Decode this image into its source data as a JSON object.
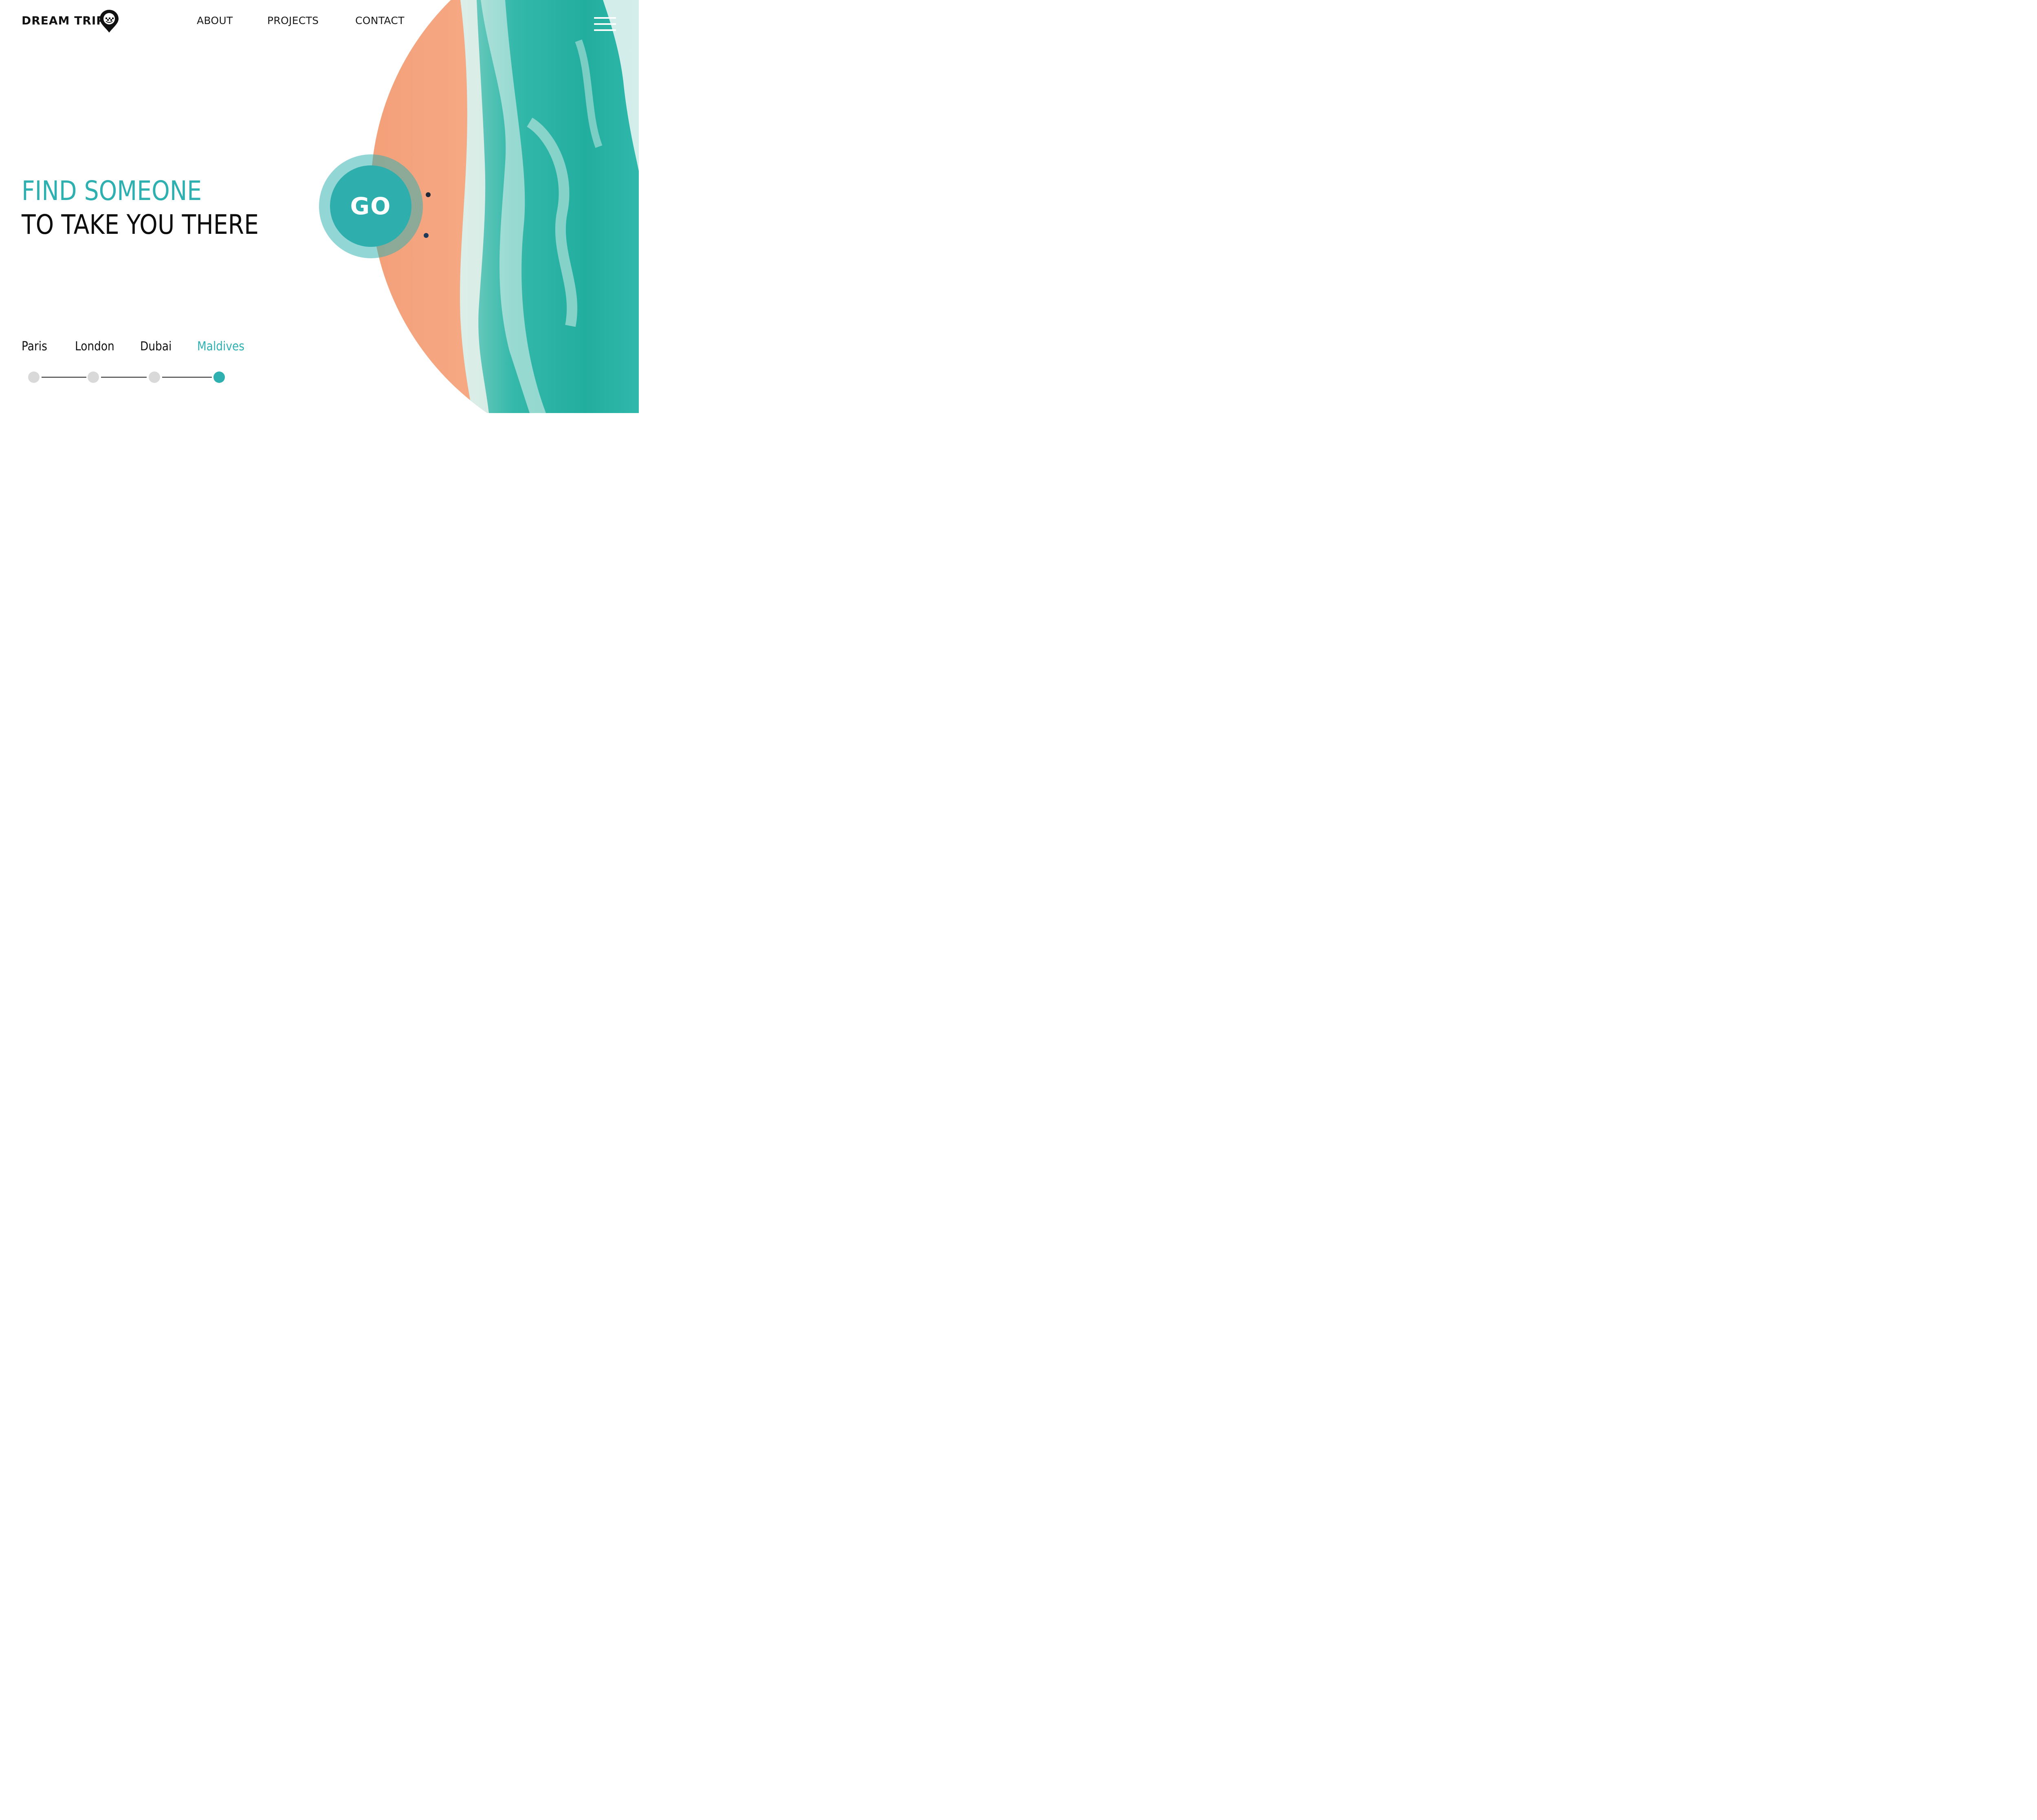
{
  "brand": {
    "name": "DREAM TRIPS",
    "logo_icon": "map-pin-icon"
  },
  "nav": {
    "items": [
      "ABOUT",
      "PROJECTS",
      "CONTACT"
    ],
    "menu_icon": "hamburger-menu-icon"
  },
  "hero": {
    "headline_accent": "FIND SOMEONE",
    "headline_main": "TO TAKE YOU THERE",
    "cta_label": "GO"
  },
  "destinations": {
    "items": [
      "Paris",
      "London",
      "Dubai",
      "Maldives"
    ],
    "selected": "Maldives"
  },
  "colors": {
    "accent": "#2eb0b0",
    "sand": "#f6a782",
    "sea": "#2bb5a8",
    "text": "#111111",
    "inactive_dot": "#d9d9d9"
  }
}
